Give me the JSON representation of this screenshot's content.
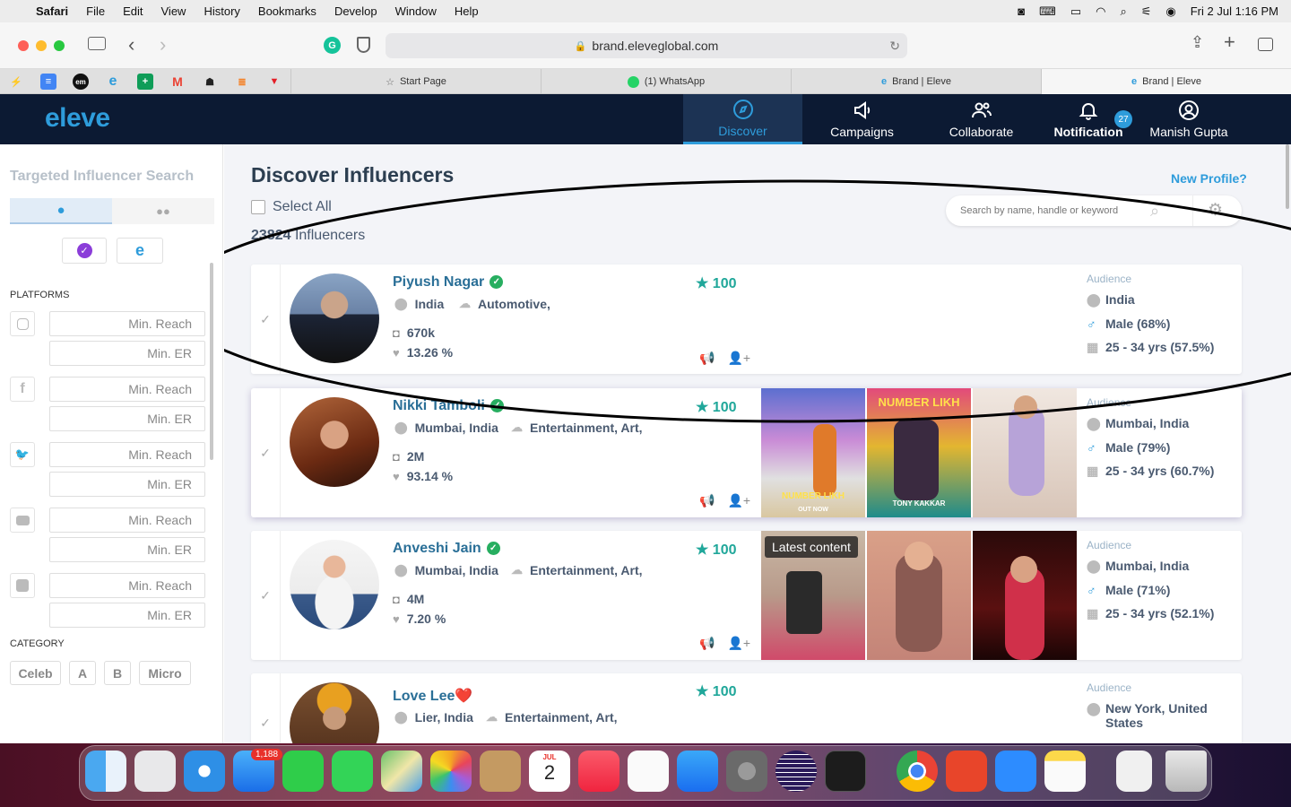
{
  "menubar": {
    "app": "Safari",
    "items": [
      "File",
      "Edit",
      "View",
      "History",
      "Bookmarks",
      "Develop",
      "Window",
      "Help"
    ],
    "datetime": "Fri 2 Jul  1:16 PM"
  },
  "browser": {
    "url": "brand.eleveglobal.com",
    "tabs": [
      {
        "label": "Start Page",
        "icon": "star-icon"
      },
      {
        "label": "(1) WhatsApp",
        "icon": "whatsapp-icon"
      },
      {
        "label": "Brand | Eleve",
        "icon": "eleve-icon"
      },
      {
        "label": "Brand | Eleve",
        "icon": "eleve-icon"
      }
    ]
  },
  "header": {
    "logo": "eleve",
    "nav": [
      {
        "label": "Discover",
        "icon": "compass-icon"
      },
      {
        "label": "Campaigns",
        "icon": "megaphone-icon"
      },
      {
        "label": "Collaborate",
        "icon": "people-icon"
      },
      {
        "label": "Notification",
        "icon": "bell-icon",
        "badge": "27"
      },
      {
        "label": "Manish Gupta",
        "icon": "user-icon"
      }
    ]
  },
  "sidebar": {
    "title": "Targeted Influencer Search",
    "platforms_label": "PLATFORMS",
    "platforms": [
      {
        "icon": "instagram-icon",
        "reach_placeholder": "Min. Reach",
        "er_placeholder": "Min. ER"
      },
      {
        "icon": "facebook-icon",
        "reach_placeholder": "Min. Reach",
        "er_placeholder": "Min. ER"
      },
      {
        "icon": "twitter-icon",
        "reach_placeholder": "Min. Reach",
        "er_placeholder": "Min. ER"
      },
      {
        "icon": "youtube-icon",
        "reach_placeholder": "Min. Reach",
        "er_placeholder": "Min. ER"
      },
      {
        "icon": "blogger-icon",
        "reach_placeholder": "Min. Reach",
        "er_placeholder": "Min. ER"
      }
    ],
    "category_label": "CATEGORY",
    "categories": [
      "Celeb",
      "A",
      "B",
      "Micro"
    ]
  },
  "main": {
    "title": "Discover Influencers",
    "new_profile": "New Profile?",
    "select_all": "Select All",
    "count_number": "23824",
    "count_suffix": "Influencers",
    "search_placeholder": "Search by name, handle or keyword",
    "latest_content": "Latest content",
    "audience_label": "Audience",
    "influencers": [
      {
        "name": "Piyush Nagar",
        "emoji": "",
        "location": "India",
        "category": "Automotive,",
        "followers": "670k",
        "er": "13.26 %",
        "score": "100",
        "audience": {
          "location": "India",
          "gender": "Male (68%)",
          "age": "25 - 34 yrs (57.5%)"
        }
      },
      {
        "name": "Nikki Tamboli",
        "emoji": "",
        "location": "Mumbai, India",
        "category": "Entertainment, Art,",
        "followers": "2M",
        "er": "93.14 %",
        "score": "100",
        "audience": {
          "location": "Mumbai, India",
          "gender": "Male (79%)",
          "age": "25 - 34 yrs (60.7%)"
        },
        "thumb_texts": [
          "NUMBER LIKH",
          "NUMBER LIKH",
          "OUT NOW",
          "TONY KAKKAR"
        ]
      },
      {
        "name": "Anveshi Jain",
        "emoji": "",
        "location": "Mumbai, India",
        "category": "Entertainment, Art,",
        "followers": "4M",
        "er": "7.20 %",
        "score": "100",
        "audience": {
          "location": "Mumbai, India",
          "gender": "Male (71%)",
          "age": "25 - 34 yrs (52.1%)"
        }
      },
      {
        "name": "Love Lee",
        "emoji": "❤️",
        "location": "Lier, India",
        "category": "Entertainment, Art,",
        "followers": "",
        "er": "",
        "score": "100",
        "audience": {
          "location": "New York, United States",
          "gender": "",
          "age": ""
        }
      }
    ]
  },
  "dock": {
    "mail_badge": "1,188",
    "calendar_month": "JUL",
    "calendar_day": "2"
  }
}
